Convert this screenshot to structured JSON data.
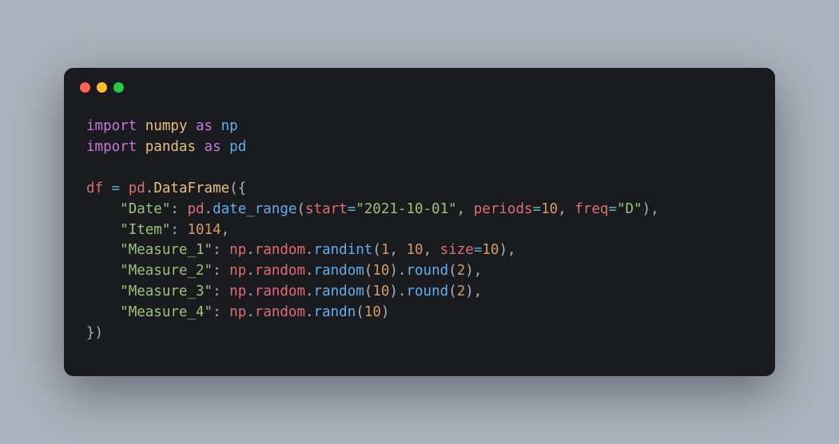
{
  "window": {
    "dots": [
      "close",
      "minimize",
      "maximize"
    ]
  },
  "code": {
    "import1": {
      "kw1": "import",
      "mod": "numpy",
      "kw2": "as",
      "alias": "np"
    },
    "import2": {
      "kw1": "import",
      "mod": "pandas",
      "kw2": "as",
      "alias": "pd"
    },
    "assign": {
      "var": "df",
      "eq": "=",
      "obj": "pd",
      "cls": "DataFrame"
    },
    "date": {
      "key": "\"Date\"",
      "obj": "pd",
      "fn": "date_range",
      "p_start": "start",
      "v_start": "\"2021-10-01\"",
      "p_periods": "periods",
      "v_periods": "10",
      "p_freq": "freq",
      "v_freq": "\"D\""
    },
    "item": {
      "key": "\"Item\"",
      "val": "1014"
    },
    "m1": {
      "key": "\"Measure_1\"",
      "obj": "np",
      "sub": "random",
      "fn": "randint",
      "a1": "1",
      "a2": "10",
      "p_size": "size",
      "v_size": "10"
    },
    "m2": {
      "key": "\"Measure_2\"",
      "obj": "np",
      "sub": "random",
      "fn": "random",
      "a1": "10",
      "rfn": "round",
      "ra": "2"
    },
    "m3": {
      "key": "\"Measure_3\"",
      "obj": "np",
      "sub": "random",
      "fn": "random",
      "a1": "10",
      "rfn": "round",
      "ra": "2"
    },
    "m4": {
      "key": "\"Measure_4\"",
      "obj": "np",
      "sub": "random",
      "fn": "randn",
      "a1": "10"
    }
  }
}
